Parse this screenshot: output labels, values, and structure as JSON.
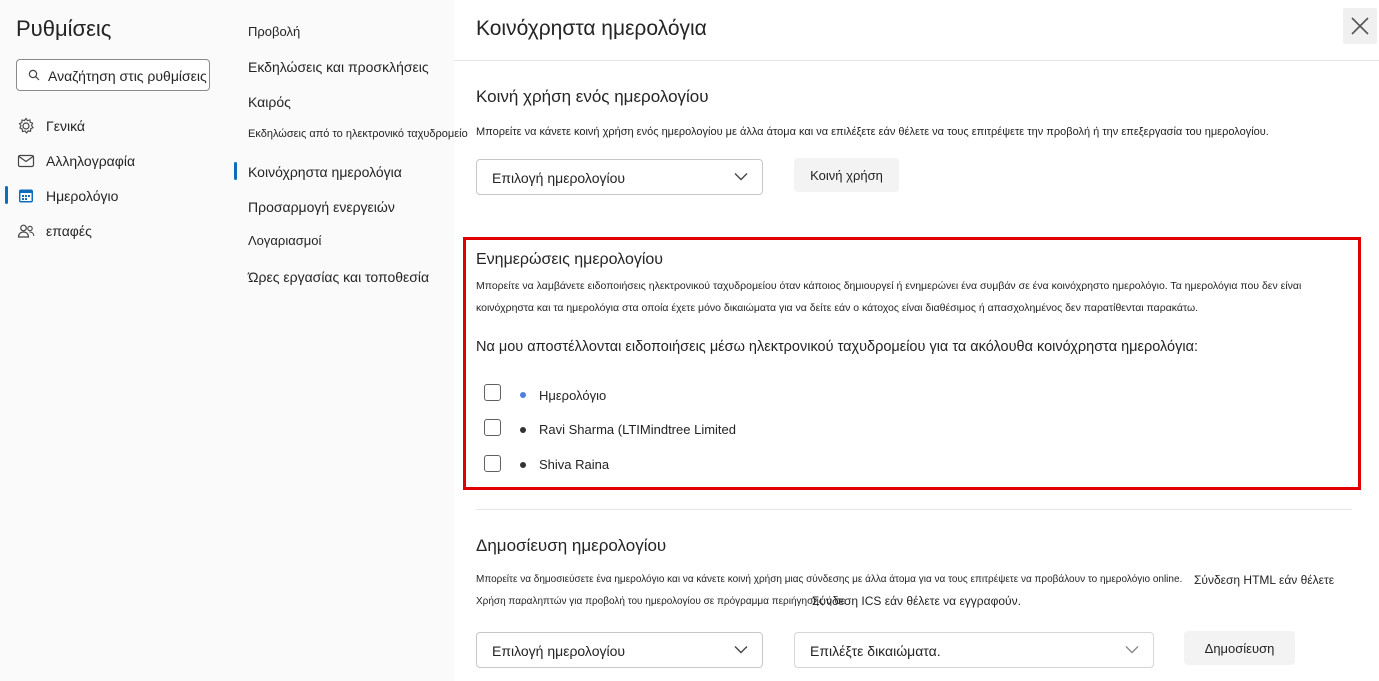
{
  "sidebar": {
    "title": "Ρυθμίσεις",
    "search_text": "Αναζήτηση στις ρυθμίσεις",
    "categories": [
      {
        "label": "Γενικά",
        "icon": "gear-icon"
      },
      {
        "label": "Αλληλογραφία",
        "icon": "mail-icon"
      },
      {
        "label": "Ημερολόγιο",
        "icon": "calendar-icon"
      },
      {
        "label": "επαφές",
        "icon": "people-icon"
      }
    ]
  },
  "subnav": {
    "items": [
      {
        "label": "Προβολή"
      },
      {
        "label": "Εκδηλώσεις και προσκλήσεις"
      },
      {
        "label": "Καιρός"
      },
      {
        "label": "Εκδηλώσεις από το ηλεκτρονικό ταχυδρομείο"
      },
      {
        "label": "Κοινόχρηστα ημερολόγια"
      },
      {
        "label": "Προσαρμογή ενεργειών"
      },
      {
        "label": "Λογαριασμοί"
      },
      {
        "label": "Ώρες εργασίας και τοποθεσία"
      }
    ]
  },
  "main": {
    "title": "Κοινόχρηστα ημερολόγια",
    "share": {
      "title": "Κοινή χρήση ενός ημερολογίου",
      "description": "Μπορείτε να κάνετε κοινή χρήση ενός ημερολογίου με άλλα άτομα και να επιλέξετε εάν θέλετε να τους επιτρέψετε την προβολή ή την επεξεργασία του ημερολογίου.",
      "dropdown": "Επιλογή ημερολογίου",
      "button": "Κοινή χρήση"
    },
    "updates": {
      "title": "Ενημερώσεις ημερολογίου",
      "description_line1": "Μπορείτε να λαμβάνετε ειδοποιήσεις ηλεκτρονικού ταχυδρομείου όταν κάποιος δημιουργεί ή ενημερώνει ένα συμβάν σε ένα κοινόχρηστο ημερολόγιο. Τα ημερολόγια που δεν είναι",
      "description_line2": "κοινόχρηστα και τα ημερολόγια στα οποία έχετε μόνο δικαιώματα για να δείτε εάν ο κάτοχος είναι διαθέσιμος ή απασχολημένος δεν παρατίθενται παρακάτω.",
      "subheading": "Να μου αποστέλλονται ειδοποιήσεις μέσω ηλεκτρονικού ταχυδρομείου για τα ακόλουθα κοινόχρηστα ημερολόγια:",
      "calendars": [
        {
          "name": "Ημερολόγιο",
          "color": "#4f7fe0",
          "checked": false
        },
        {
          "name": "Ravi Sharma (LTIMindtree Limited",
          "color": "#333333",
          "checked": false
        },
        {
          "name": "Shiva Raina",
          "color": "#333333",
          "checked": false
        }
      ]
    },
    "publish": {
      "title": "Δημοσίευση ημερολογίου",
      "line1": "Μπορείτε να δημοσιεύσετε ένα ημερολόγιο και να κάνετε κοινή χρήση μιας σύνδεσης με άλλα άτομα για να τους επιτρέψετε να προβάλουν το ημερολόγιο online.",
      "line1_right": "Σύνδεση HTML εάν θέλετε",
      "line2": "Χρήση παραληπτών για προβολή του ημερολογίου σε πρόγραμμα περιήγησης ή σε",
      "line2_right": "Σύνδεση ICS εάν θέλετε να εγγραφούν.",
      "dropdown_calendar": "Επιλογή ημερολογίου",
      "dropdown_permissions": "Επιλέξτε δικαιώματα.",
      "button": "Δημοσίευση"
    }
  },
  "colors": {
    "accent": "#0f6cbd",
    "highlight": "#e00000"
  }
}
